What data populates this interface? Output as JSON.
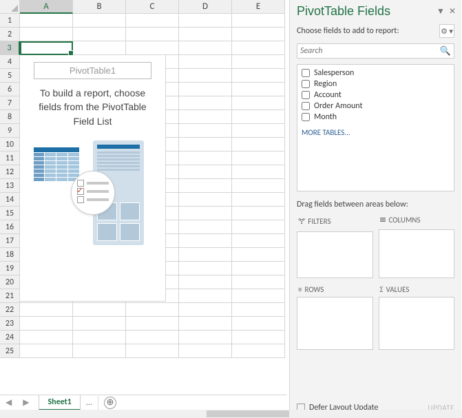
{
  "columns": [
    "A",
    "B",
    "C",
    "D",
    "E"
  ],
  "rows": [
    "1",
    "2",
    "3",
    "4",
    "5",
    "6",
    "7",
    "8",
    "9",
    "10",
    "11",
    "12",
    "13",
    "14",
    "15",
    "16",
    "17",
    "18",
    "19",
    "20",
    "21",
    "22",
    "23",
    "24",
    "25"
  ],
  "active_row": "3",
  "active_col": "A",
  "pivot": {
    "name": "PivotTable1",
    "instruction": "To build a report, choose fields from the PivotTable Field List"
  },
  "sheet": {
    "active_tab": "Sheet1",
    "ellipsis": "..."
  },
  "pane": {
    "title": "PivotTable Fields",
    "subtitle": "Choose fields to add to report:",
    "search_placeholder": "Search",
    "fields": [
      "Salesperson",
      "Region",
      "Account",
      "Order Amount",
      "Month"
    ],
    "more_tables": "MORE TABLES...",
    "drag_label": "Drag fields between areas below:",
    "areas": {
      "filters": "FILTERS",
      "columns": "COLUMNS",
      "rows": "ROWS",
      "values": "VALUES"
    },
    "defer_label": "Defer Layout Update",
    "update_label": "UPDATE"
  }
}
